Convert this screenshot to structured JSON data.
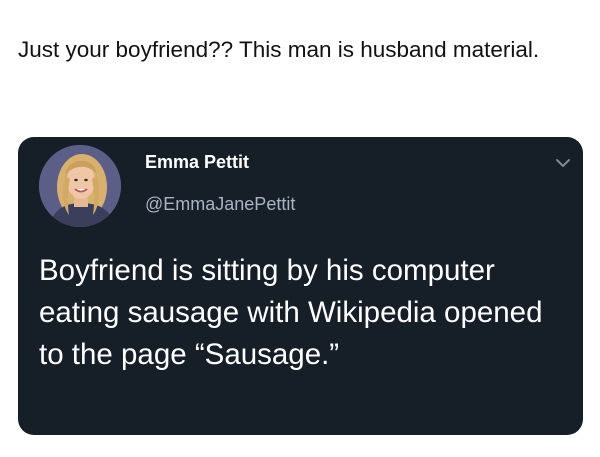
{
  "post": {
    "caption": "Just your boyfriend?? This man is husband material."
  },
  "tweet": {
    "display_name": "Emma Pettit",
    "handle": "@EmmaJanePettit",
    "text": "Boyfriend is sitting by his computer eating sausage with Wikipedia opened to the page “Sausage.”",
    "avatar_icon": "profile-photo",
    "menu_icon": "chevron-down-icon"
  },
  "colors": {
    "card_background": "#161e28",
    "handle_text": "#a9b5c2",
    "caption_text": "#111111"
  }
}
